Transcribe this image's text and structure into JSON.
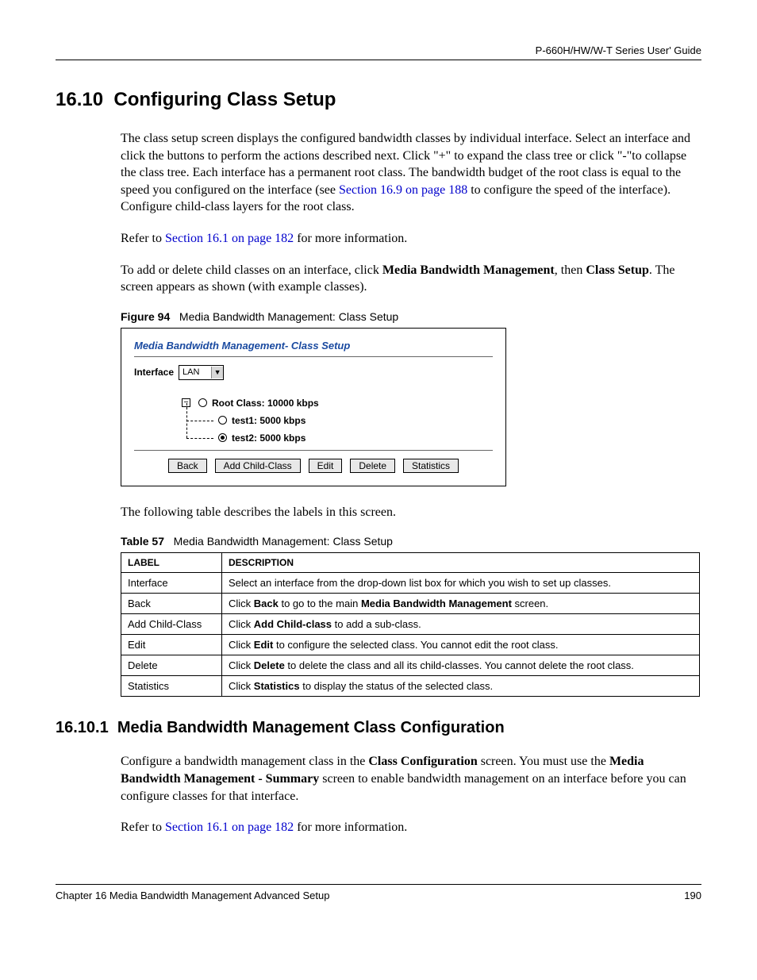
{
  "header": {
    "guide_title": "P-660H/HW/W-T Series User' Guide"
  },
  "section": {
    "number": "16.10",
    "title": "Configuring Class Setup",
    "para1_pre": "The class setup screen displays the configured bandwidth classes by individual interface. Select an interface and click the buttons to perform the actions described next. Click \"+\" to expand the class tree or click \"-\"to collapse the class tree. Each interface has a permanent root class. The bandwidth budget of the root class is equal to the speed you configured on the interface (see ",
    "para1_link": "Section 16.9 on page 188",
    "para1_post": " to configure the speed of the interface). Configure child-class layers for the root class.",
    "para2_pre": "Refer to ",
    "para2_link": "Section 16.1 on page 182",
    "para2_post": " for more information.",
    "para3_pre": "To add or delete child classes on an interface, click ",
    "para3_bold1": "Media Bandwidth Management",
    "para3_mid": ", then ",
    "para3_bold2": "Class Setup",
    "para3_post": ". The screen appears as shown (with example classes).",
    "after_figure": "The following table describes the labels in this screen."
  },
  "figure": {
    "label": "Figure 94",
    "caption": "Media Bandwidth Management: Class Setup",
    "panel_title": "Media Bandwidth Management- Class Setup",
    "interface_label": "Interface",
    "interface_value": "LAN",
    "tree": {
      "root": "Root Class: 10000 kbps",
      "child1": "test1: 5000 kbps",
      "child2": "test2: 5000 kbps"
    },
    "buttons": {
      "back": "Back",
      "add": "Add Child-Class",
      "edit": "Edit",
      "delete": "Delete",
      "stats": "Statistics"
    }
  },
  "table": {
    "label": "Table 57",
    "caption": "Media Bandwidth Management: Class Setup",
    "headers": {
      "c1": "LABEL",
      "c2": "DESCRIPTION"
    },
    "rows": [
      {
        "label": "Interface",
        "desc_pre": "Select an interface from the drop-down list box for which you wish to set up classes.",
        "bold": "",
        "desc_post": ""
      },
      {
        "label": "Back",
        "desc_pre": "Click ",
        "bold": "Back",
        "desc_mid": " to go to the main ",
        "bold2": "Media Bandwidth Management",
        "desc_post": " screen."
      },
      {
        "label": "Add Child-Class",
        "desc_pre": "Click ",
        "bold": "Add Child-class",
        "desc_post": " to add a sub-class."
      },
      {
        "label": "Edit",
        "desc_pre": "Click ",
        "bold": "Edit",
        "desc_post": " to configure the selected class. You cannot edit the root class."
      },
      {
        "label": "Delete",
        "desc_pre": "Click ",
        "bold": "Delete",
        "desc_post": " to delete the class and all its child-classes. You cannot delete the root class."
      },
      {
        "label": "Statistics",
        "desc_pre": "Click ",
        "bold": "Statistics",
        "desc_post": " to display the status of the selected class."
      }
    ]
  },
  "subsection": {
    "number": "16.10.1",
    "title": "Media Bandwidth Management Class Configuration",
    "para1_pre": "Configure a bandwidth management class in the ",
    "para1_bold1": "Class Configuration",
    "para1_mid": " screen. You must use the ",
    "para1_bold2": "Media Bandwidth Management - Summary",
    "para1_post": " screen to enable bandwidth management on an interface before you can configure classes for that interface.",
    "para2_pre": "Refer to ",
    "para2_link": "Section 16.1 on page 182",
    "para2_post": " for more information."
  },
  "footer": {
    "chapter": "Chapter 16 Media Bandwidth Management Advanced Setup",
    "page": "190"
  }
}
